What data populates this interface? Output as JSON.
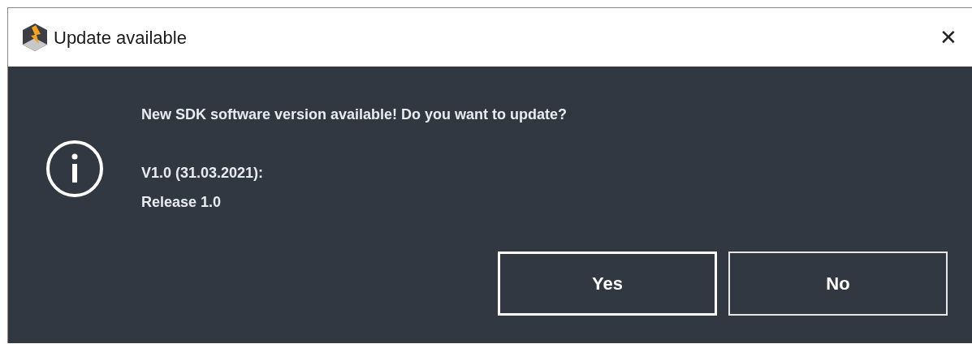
{
  "window": {
    "title": "Update available",
    "close": "✕"
  },
  "message": {
    "question": "New SDK software version available! Do you want to update?",
    "details": [
      "V1.0 (31.03.2021):",
      "Release 1.0"
    ]
  },
  "buttons": [
    {
      "label": "Yes",
      "focused": true
    },
    {
      "label": "No",
      "focused": false
    }
  ]
}
